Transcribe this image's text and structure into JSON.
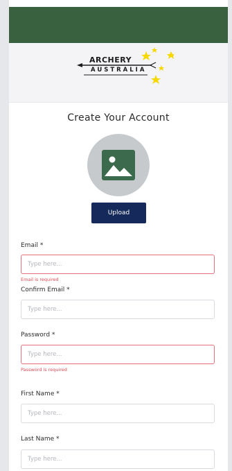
{
  "logo": {
    "line1": "ARCHERY",
    "line2": "AUSTRALIA",
    "accent_color": "#f5d800"
  },
  "header": {
    "bar_color": "#39603f",
    "title": "Create Your Account"
  },
  "avatar": {
    "icon": "image-placeholder-icon",
    "upload_label": "Upload"
  },
  "form": {
    "email": {
      "label": "Email *",
      "placeholder": "Type here...",
      "error": "Email is required"
    },
    "confirm_email": {
      "label": "Confirm Email *",
      "placeholder": "Type here..."
    },
    "password": {
      "label": "Password *",
      "placeholder": "Type here...",
      "error": "Password is required"
    },
    "first_name": {
      "label": "First Name *",
      "placeholder": "Type here..."
    },
    "last_name": {
      "label": "Last Name *",
      "placeholder": "Type here..."
    }
  },
  "colors": {
    "error": "#e24a55",
    "button": "#152a5a"
  }
}
